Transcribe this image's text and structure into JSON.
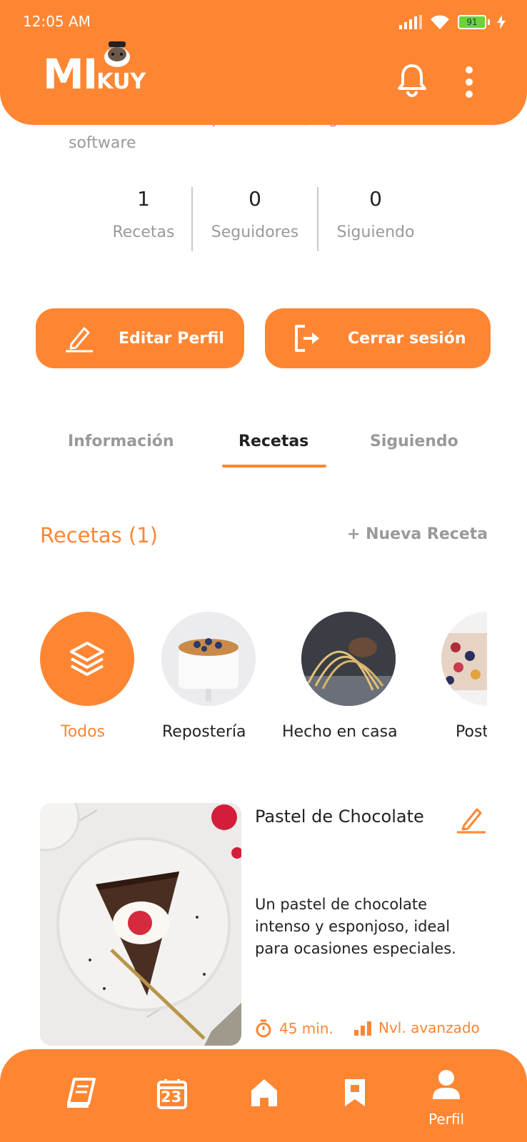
{
  "status_bar": {
    "time": "12:05 AM",
    "battery": "91"
  },
  "app": {
    "logo_main": "MI",
    "logo_sub": "KUY"
  },
  "profile": {
    "bio_partial": "desarrollador de aplicaciones , ingeniero de software",
    "stats": [
      {
        "value": "1",
        "label": "Recetas"
      },
      {
        "value": "0",
        "label": "Seguidores"
      },
      {
        "value": "0",
        "label": "Siguiendo"
      }
    ],
    "edit_button": "Editar Perfil",
    "logout_button": "Cerrar sesión"
  },
  "tabs": [
    {
      "label": "Información",
      "active": false
    },
    {
      "label": "Recetas",
      "active": true
    },
    {
      "label": "Siguiendo",
      "active": false
    }
  ],
  "recipes_section": {
    "title": "Recetas (1)",
    "new_recipe": "+ Nueva Receta"
  },
  "categories": [
    {
      "label": "Todos",
      "active": true,
      "icon": "layers-icon"
    },
    {
      "label": "Repostería",
      "active": false
    },
    {
      "label": "Hecho en casa",
      "active": false
    },
    {
      "label": "Postres",
      "active": false
    }
  ],
  "recipe": {
    "title": "Pastel de Chocolate",
    "description": "Un pastel de chocolate intenso y esponjoso, ideal para ocasiones especiales.",
    "time": "45 min.",
    "level": "Nvl. avanzado"
  },
  "bottom_nav": {
    "items": [
      "book-icon",
      "calendar-icon",
      "home-icon",
      "bookmark-icon",
      "profile-icon"
    ],
    "calendar_day": "23",
    "active_label": "Perfil"
  },
  "colors": {
    "accent": "#FE8633",
    "text": "#222222",
    "muted": "#9A9A9A"
  }
}
